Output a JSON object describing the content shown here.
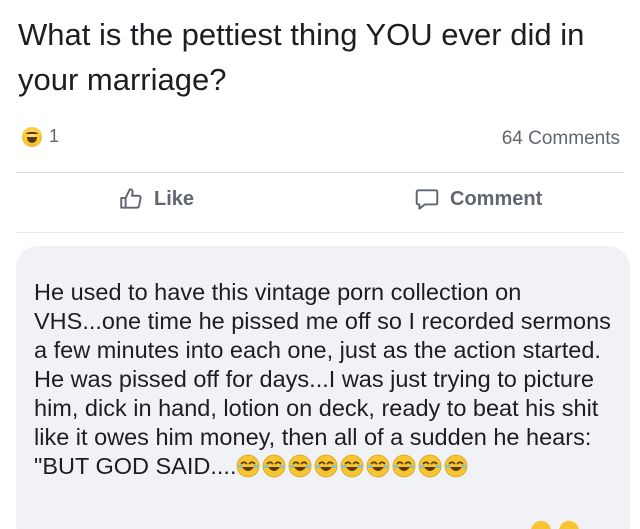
{
  "post": {
    "title": "What is the pettiest thing YOU ever did in your marriage?"
  },
  "reactions": {
    "icon": "haha-emoji-icon",
    "count": "1"
  },
  "comments_count": "64 Comments",
  "actions": {
    "like_label": "Like",
    "comment_label": "Comment"
  },
  "comment": {
    "text": "He used to have this vintage porn collection on VHS...one time he pissed me off so I recorded sermons a few minutes into each one, just as the action started. He was pissed off for days...I was just trying to picture him, dick in hand, lotion on deck, ready to beat his shit like it owes him money, then all of a sudden he hears: \"BUT GOD SAID....",
    "emoji_count": 9,
    "emoji_icon": "laughing-crying-emoji-icon"
  },
  "colors": {
    "text": "#1c1e21",
    "secondary_text": "#606770",
    "comment_bubble": "#f0f2f5",
    "divider": "#dadde1",
    "emoji_yellow": "#f7c531"
  }
}
